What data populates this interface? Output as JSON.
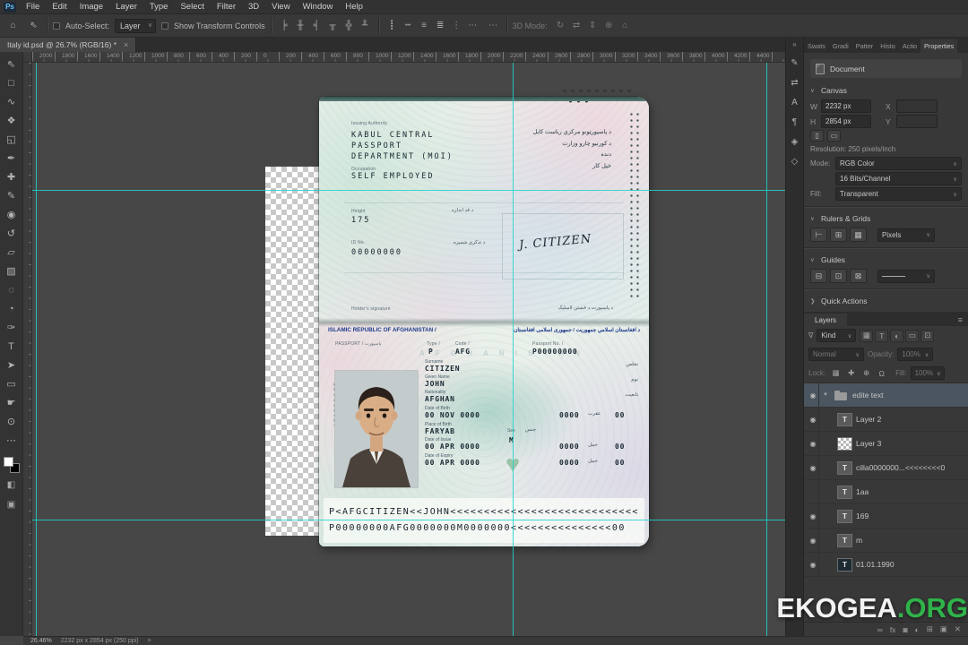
{
  "app": {
    "logo_text": "Ps",
    "watermark_main": "EKOGEA",
    "watermark_suffix": ".ORG"
  },
  "menu_bar": {
    "items": [
      {
        "label": "File",
        "name": "menu-file"
      },
      {
        "label": "Edit",
        "name": "menu-edit"
      },
      {
        "label": "Image",
        "name": "menu-image"
      },
      {
        "label": "Layer",
        "name": "menu-layer"
      },
      {
        "label": "Type",
        "name": "menu-type"
      },
      {
        "label": "Select",
        "name": "menu-select"
      },
      {
        "label": "Filter",
        "name": "menu-filter"
      },
      {
        "label": "3D",
        "name": "menu-3d"
      },
      {
        "label": "View",
        "name": "menu-view"
      },
      {
        "label": "Window",
        "name": "menu-window"
      },
      {
        "label": "Help",
        "name": "menu-help"
      }
    ]
  },
  "options_bar": {
    "home_glyph": "⌂",
    "tool_glyph": "⇖",
    "auto_select_label": "Auto-Select:",
    "auto_select_value": "Layer",
    "show_transform_label": "Show Transform Controls",
    "more_glyph": "⋯",
    "mode_3d_label": "3D Mode:",
    "align_icons": [
      {
        "glyph": "╞",
        "name": "align-left-edges-icon"
      },
      {
        "glyph": "╫",
        "name": "align-horizontal-centers-icon"
      },
      {
        "glyph": "╡",
        "name": "align-right-edges-icon"
      },
      {
        "glyph": "╥",
        "name": "align-top-edges-icon"
      },
      {
        "glyph": "╬",
        "name": "align-vertical-centers-icon"
      },
      {
        "glyph": "╨",
        "name": "align-bottom-edges-icon"
      }
    ],
    "distribute_icons": [
      {
        "glyph": "┋",
        "name": "distribute-vertical-icon"
      },
      {
        "glyph": "┅",
        "name": "distribute-horizontal-icon"
      },
      {
        "glyph": "≡",
        "name": "distribute-left-icon"
      },
      {
        "glyph": "≣",
        "name": "distribute-center-icon"
      },
      {
        "glyph": "⋮",
        "name": "distribute-top-icon"
      },
      {
        "glyph": "⋯",
        "name": "distribute-bottom-icon"
      }
    ],
    "mode_3d_icons": [
      {
        "glyph": "↻",
        "name": "3d-rotate-icon"
      },
      {
        "glyph": "⇄",
        "name": "3d-roll-icon"
      },
      {
        "glyph": "⇕",
        "name": "3d-drag-icon"
      },
      {
        "glyph": "⊕",
        "name": "3d-slide-icon"
      },
      {
        "glyph": "⌂",
        "name": "3d-scale-icon"
      }
    ]
  },
  "tab_bar": {
    "title": "Italy id.psd @ 26.7% (RGB/16) *",
    "close_glyph": "×"
  },
  "toolbar": {
    "tools": [
      {
        "glyph": "⇖",
        "name": "move-tool"
      },
      {
        "glyph": "□",
        "name": "marquee-tool"
      },
      {
        "glyph": "∿",
        "name": "lasso-tool"
      },
      {
        "glyph": "❖",
        "name": "quick-selection-tool"
      },
      {
        "glyph": "◱",
        "name": "crop-tool"
      },
      {
        "glyph": "✒",
        "name": "eyedropper-tool"
      },
      {
        "glyph": "✚",
        "name": "healing-brush-tool"
      },
      {
        "glyph": "✎",
        "name": "brush-tool"
      },
      {
        "glyph": "◉",
        "name": "clone-stamp-tool"
      },
      {
        "glyph": "↺",
        "name": "history-brush-tool"
      },
      {
        "glyph": "▱",
        "name": "eraser-tool"
      },
      {
        "glyph": "▨",
        "name": "gradient-tool"
      },
      {
        "glyph": "◌",
        "name": "blur-tool"
      },
      {
        "glyph": "◔",
        "name": "dodge-tool"
      },
      {
        "glyph": "✑",
        "name": "pen-tool"
      },
      {
        "glyph": "T",
        "name": "type-tool"
      },
      {
        "glyph": "➤",
        "name": "path-selection-tool"
      },
      {
        "glyph": "▭",
        "name": "shape-tool"
      },
      {
        "glyph": "☛",
        "name": "hand-tool"
      },
      {
        "glyph": "⊙",
        "name": "zoom-tool"
      },
      {
        "glyph": "⋯",
        "name": "edit-toolbar-icon"
      }
    ],
    "quick_mask_glyph": "◧",
    "screen_mode_glyph": "▣"
  },
  "ruler": {
    "labels": [
      "2000",
      "1800",
      "1600",
      "1400",
      "1200",
      "1000",
      "800",
      "600",
      "400",
      "200",
      "0",
      "200",
      "400",
      "600",
      "800",
      "1000",
      "1200",
      "1400",
      "1600",
      "1800",
      "2000",
      "2200",
      "2400",
      "2600",
      "2800",
      "3000",
      "3200",
      "3400",
      "3600",
      "3800",
      "4000",
      "4200",
      "4400"
    ]
  },
  "dock": {
    "collapse_glyph": "«",
    "icons": [
      {
        "glyph": "✎",
        "name": "brush-settings-panel-icon"
      },
      {
        "glyph": "⇄",
        "name": "clone-source-panel-icon"
      },
      {
        "glyph": "A",
        "name": "character-panel-icon"
      },
      {
        "glyph": "¶",
        "name": "paragraph-panel-icon"
      },
      {
        "glyph": "◈",
        "name": "glyphs-panel-icon"
      },
      {
        "glyph": "◇",
        "name": "3d-panel-icon"
      }
    ]
  },
  "properties_panel": {
    "tabs": [
      {
        "label": "Swats",
        "name": "tab-swatches",
        "cls": ""
      },
      {
        "label": "Gradi",
        "name": "tab-gradients",
        "cls": ""
      },
      {
        "label": "Patter",
        "name": "tab-patterns",
        "cls": ""
      },
      {
        "label": "Histo",
        "name": "tab-histogram",
        "cls": ""
      },
      {
        "label": "Actio",
        "name": "tab-actions",
        "cls": ""
      },
      {
        "label": "Properties",
        "name": "tab-properties",
        "cls": "active"
      }
    ],
    "document_label": "Document",
    "chevron_open": "∨",
    "chevron_closed": "❯",
    "canvas_section": "Canvas",
    "w_label": "W",
    "w_value": "2232 px",
    "h_label": "H",
    "h_value": "2854 px",
    "x_label": "X",
    "y_label": "Y",
    "portrait_glyph": "▯",
    "landscape_glyph": "▭",
    "resolution_text": "Resolution: 250 pixels/inch",
    "mode_label": "Mode:",
    "mode_value": "RGB Color",
    "depth_value": "16 Bits/Channel",
    "fill_label": "Fill:",
    "fill_value": "Transparent",
    "rulers_section": "Rulers & Grids",
    "ruler_icons": [
      {
        "glyph": "⊢",
        "name": "toggle-rulers-icon"
      },
      {
        "glyph": "⊞",
        "name": "toggle-grid-icon"
      },
      {
        "glyph": "▦",
        "name": "grid-settings-icon"
      }
    ],
    "rulers_unit": "Pixels",
    "guides_section": "Guides",
    "guide_icons": [
      {
        "glyph": "⊟",
        "name": "new-guide-layout-icon"
      },
      {
        "glyph": "⊡",
        "name": "lock-guides-icon"
      },
      {
        "glyph": "⊠",
        "name": "clear-guides-icon"
      }
    ],
    "quick_actions_section": "Quick Actions"
  },
  "layers_panel": {
    "tab_label": "Layers",
    "menu_glyph": "≡",
    "filter_funnel": "∇",
    "filter_label": "Kind",
    "filter_icons": [
      {
        "glyph": "▦",
        "name": "filter-pixel-layers-icon"
      },
      {
        "glyph": "T",
        "name": "filter-type-layers-icon"
      },
      {
        "glyph": "◐",
        "name": "filter-adjustment-layers-icon"
      },
      {
        "glyph": "▭",
        "name": "filter-shape-layers-icon"
      },
      {
        "glyph": "⊡",
        "name": "filter-smart-objects-icon"
      }
    ],
    "blend_value": "Normal",
    "opacity_label": "Opacity:",
    "opacity_value": "100%",
    "lock_label": "Lock:",
    "lock_icons": [
      {
        "glyph": "▦",
        "name": "lock-transparent-pixels-icon"
      },
      {
        "glyph": "✚",
        "name": "lock-image-pixels-icon"
      },
      {
        "glyph": "⊕",
        "name": "lock-position-icon"
      },
      {
        "glyph": "Ω",
        "name": "lock-all-icon"
      }
    ],
    "fill_label": "Fill:",
    "fill_value": "100%",
    "eye_glyph": "◉",
    "layers": [
      {
        "label": "edite text",
        "row_class": "selected",
        "thumb_class": "folder",
        "glyph": "",
        "chev": "▼",
        "visible": true
      },
      {
        "label": "Layer 2",
        "row_class": "child",
        "thumb_class": "text",
        "glyph": "T",
        "chev": "",
        "visible": true
      },
      {
        "label": "Layer 3",
        "row_class": "child",
        "thumb_class": "checker",
        "glyph": "",
        "chev": "",
        "visible": true
      },
      {
        "label": "cilla0000000...<<<<<<<<0",
        "row_class": "child",
        "thumb_class": "text",
        "glyph": "T",
        "chev": "",
        "visible": true
      },
      {
        "label": "1aa",
        "row_class": "child",
        "thumb_class": "text",
        "glyph": "T",
        "chev": "",
        "visible": false
      },
      {
        "label": "169",
        "row_class": "child",
        "thumb_class": "text",
        "glyph": "T",
        "chev": "",
        "visible": true
      },
      {
        "label": "m",
        "row_class": "child",
        "thumb_class": "text",
        "glyph": "T",
        "chev": "",
        "visible": true
      },
      {
        "label": "01.01.1990",
        "row_class": "child",
        "thumb_class": "dark",
        "glyph": "T",
        "chev": "",
        "visible": true
      }
    ],
    "bottom_icons": [
      {
        "glyph": "∞",
        "name": "link-layers-icon"
      },
      {
        "glyph": "fx",
        "name": "layer-effects-icon"
      },
      {
        "glyph": "◙",
        "name": "layer-mask-icon"
      },
      {
        "glyph": "◐",
        "name": "adjustment-layer-icon"
      },
      {
        "glyph": "⊞",
        "name": "layer-group-icon"
      },
      {
        "glyph": "▣",
        "name": "new-layer-icon"
      },
      {
        "glyph": "✕",
        "name": "delete-layer-icon"
      }
    ]
  },
  "status_bar": {
    "zoom": "26.46%",
    "doc_info": "2232 px x 2854 px (250 ppi)",
    "chevron": ">"
  },
  "passport": {
    "page1": {
      "issuing_authority_label": "Issuing Authority",
      "issuing_authority_l1": "KABUL CENTRAL",
      "issuing_authority_l2": "PASSPORT",
      "issuing_authority_l3": "DEPARTMENT (MOI)",
      "ar_line1": "د پاسپورټونو مرکزي ریاست کابل",
      "ar_line2": "د کورنیو چارو وزارت",
      "ar_line3": "دنده",
      "ar_line4": "خپل کار",
      "occupation_label": "Occupation",
      "occupation": "SELF EMPLOYED",
      "height_label": "Height",
      "height": "175",
      "height_ar": "د قد اندازه",
      "id_label": "ID No.",
      "id_number": "00000000",
      "id_ar": "د تذکرې شمېره",
      "signature": "J. CITIZEN",
      "footer_left": "Holder's signature",
      "footer_right": "د پاسپورت د څښتن لاسلیک"
    },
    "page2": {
      "header_en": "ISLAMIC REPUBLIC OF AFGHANISTAN /",
      "header_ar": "د افغانستان اسلامي جمهوریت / جمهوری اسلامی افغانستان",
      "passport_word": "PASSPORT / پاسپورت",
      "type_label": "Type /",
      "code_label": "Code /",
      "passport_no_label": "Passport No. /",
      "type_value": "P",
      "code_value": "AFG",
      "passport_no_value": "P00000000",
      "watermark_text": "A F G H A N I S T A N",
      "surname_label": "Surname",
      "surname": "CITIZEN",
      "surname_ar": "تخلص",
      "given_name_label": "Given Name",
      "given_name": "JOHN",
      "given_name_ar": "نوم",
      "nationality_label": "Nationality",
      "nationality": "AFGHAN",
      "nationality_ar": "تابعیت",
      "dob_label": "Date of Birth",
      "dob": "00 NOV 0000",
      "dob_aux": "0000",
      "dob_ar": "عقرب",
      "dob_aux2": "00",
      "pob_label": "Place of Birth",
      "pob": "FARYAB",
      "sex_label": "Sex",
      "sex": "M",
      "sex_ar": "جنس",
      "doi_label": "Date of Issue",
      "doi": "00 APR 0000",
      "doi_aux": "0000",
      "doi_ar": "حمل",
      "doi_aux2": "00",
      "doe_label": "Date of Expiry",
      "doe": "00 APR 0000",
      "doe_aux": "0000",
      "doe_ar": "حمل",
      "doe_aux2": "00",
      "vertical_text": "پاسپورت PASSPORT",
      "mrz1": "P<AFGCITIZEN<<JOHN<<<<<<<<<<<<<<<<<<<<<<<<<<<<",
      "mrz2": "P00000000AFG0000000M0000000<<<<<<<<<<<<<<<00"
    }
  }
}
